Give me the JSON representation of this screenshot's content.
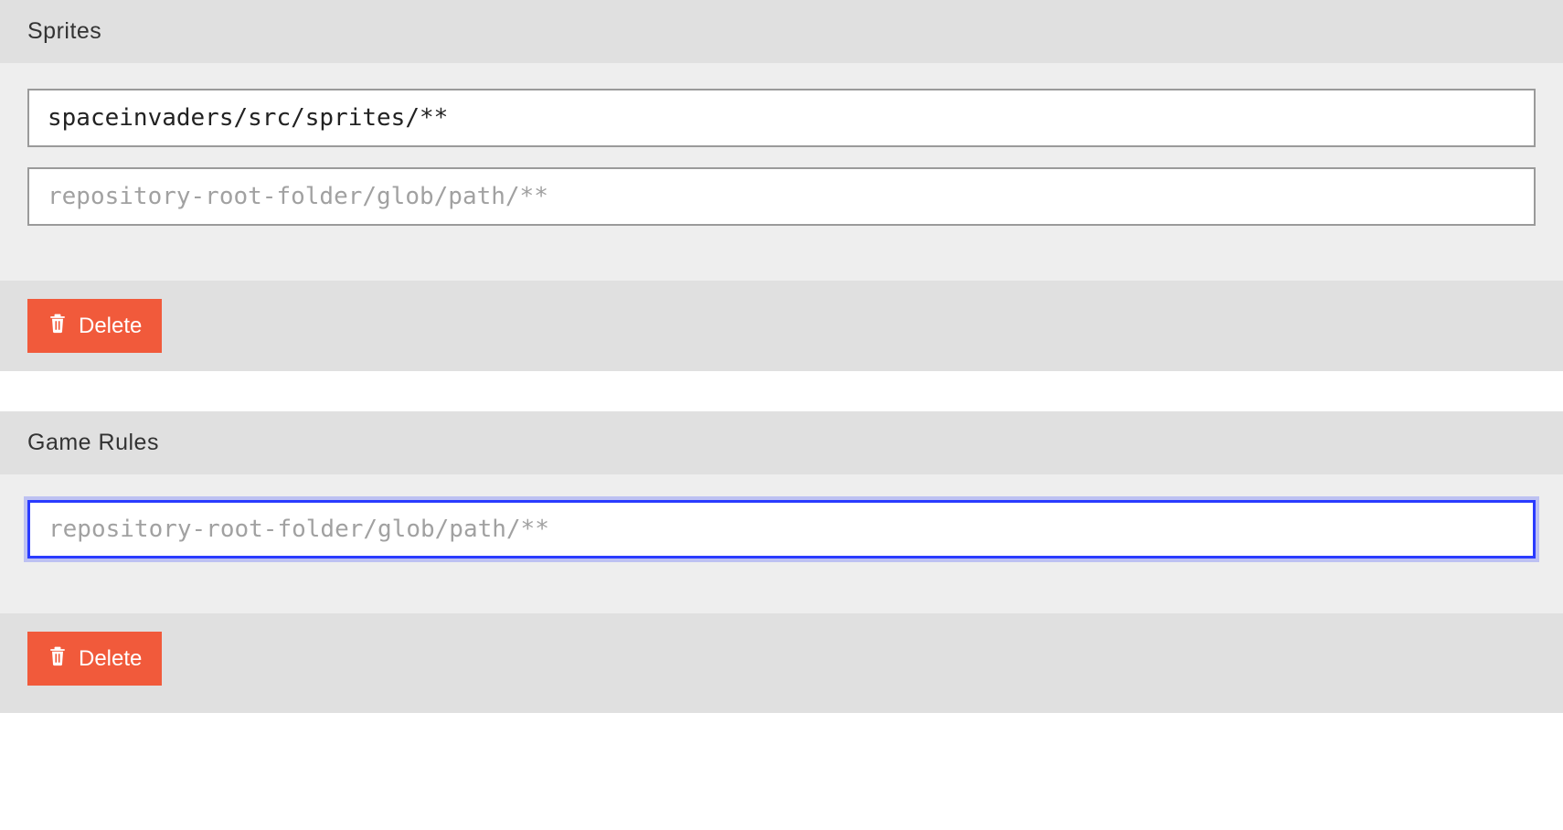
{
  "sections": [
    {
      "title": "Sprites",
      "inputs": [
        {
          "value": "spaceinvaders/src/sprites/**",
          "placeholder": "repository-root-folder/glob/path/**",
          "focused": false
        },
        {
          "value": "",
          "placeholder": "repository-root-folder/glob/path/**",
          "focused": false
        }
      ],
      "delete_label": "Delete"
    },
    {
      "title": "Game Rules",
      "inputs": [
        {
          "value": "",
          "placeholder": "repository-root-folder/glob/path/**",
          "focused": true
        }
      ],
      "delete_label": "Delete"
    }
  ]
}
